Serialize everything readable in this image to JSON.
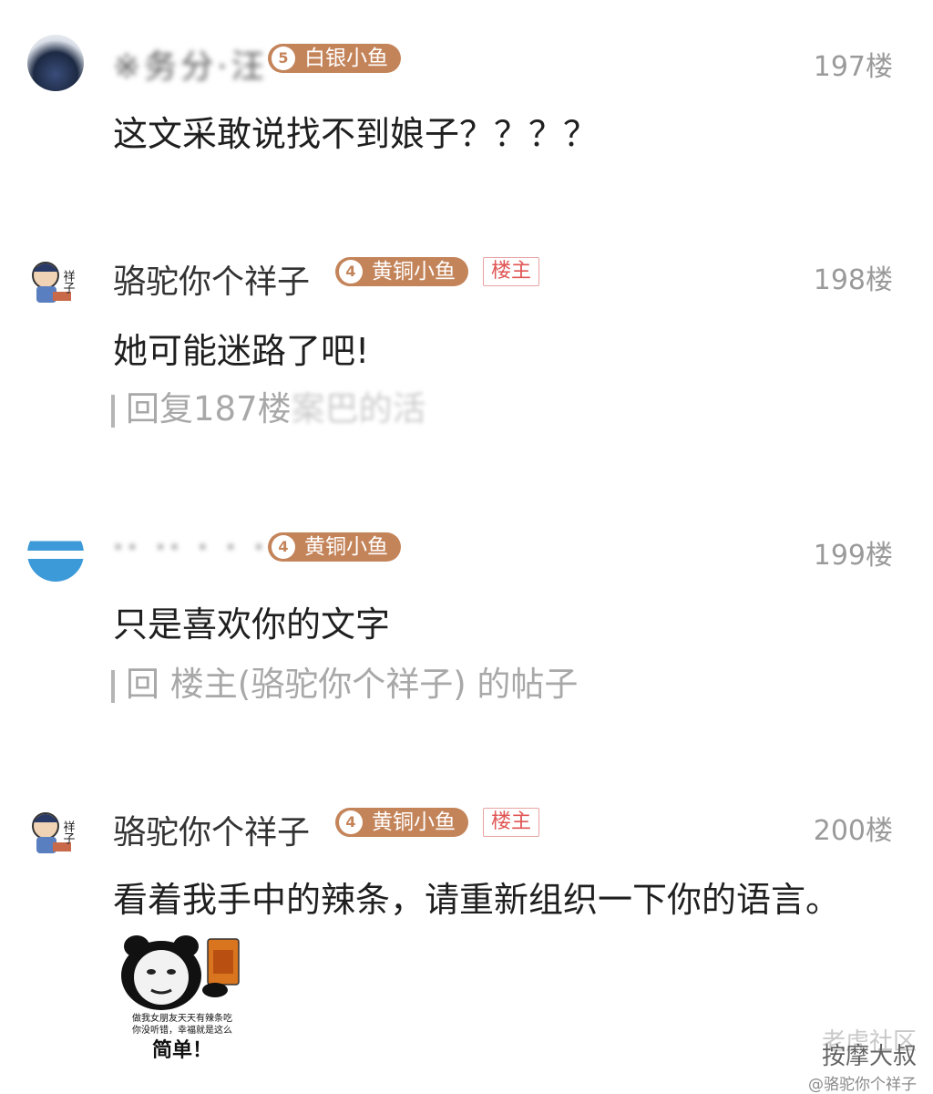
{
  "posts": [
    {
      "username": "※务分·汪",
      "badge": "白银小鱼",
      "badge_level": "5",
      "floor": "197楼",
      "content": "这文采敢说找不到娘子？？？？"
    },
    {
      "username": "骆驼你个祥子",
      "badge": "黄铜小鱼",
      "badge_level": "4",
      "op_tag": "楼主",
      "floor": "198楼",
      "content": "她可能迷路了吧!",
      "reply_prefix": "回复187楼",
      "reply_suffix": "案巴的活"
    },
    {
      "username": "·· ·· · · · ·",
      "badge": "黄铜小鱼",
      "badge_level": "4",
      "floor": "199楼",
      "content": "只是喜欢你的文字",
      "reply": "回 楼主(骆驼你个祥子) 的帖子"
    },
    {
      "username": "骆驼你个祥子",
      "badge": "黄铜小鱼",
      "badge_level": "4",
      "op_tag": "楼主",
      "floor": "200楼",
      "content": "看着我手中的辣条，请重新组织一下你的语言。",
      "meme": {
        "line1": "做我女朋友天天有辣条吃",
        "line2": "你没听错，幸福就是这么",
        "line3": "简单！"
      }
    }
  ],
  "avatar_text": "祥子",
  "watermark": {
    "line1": "老虎社区",
    "line2": "按摩大叔",
    "line3": "@骆驼你个祥子"
  },
  "colors": {
    "badge": "#c4845a",
    "op_tag": "#e05555",
    "floor": "#9a9a9a",
    "reply": "#a8a8a8"
  }
}
